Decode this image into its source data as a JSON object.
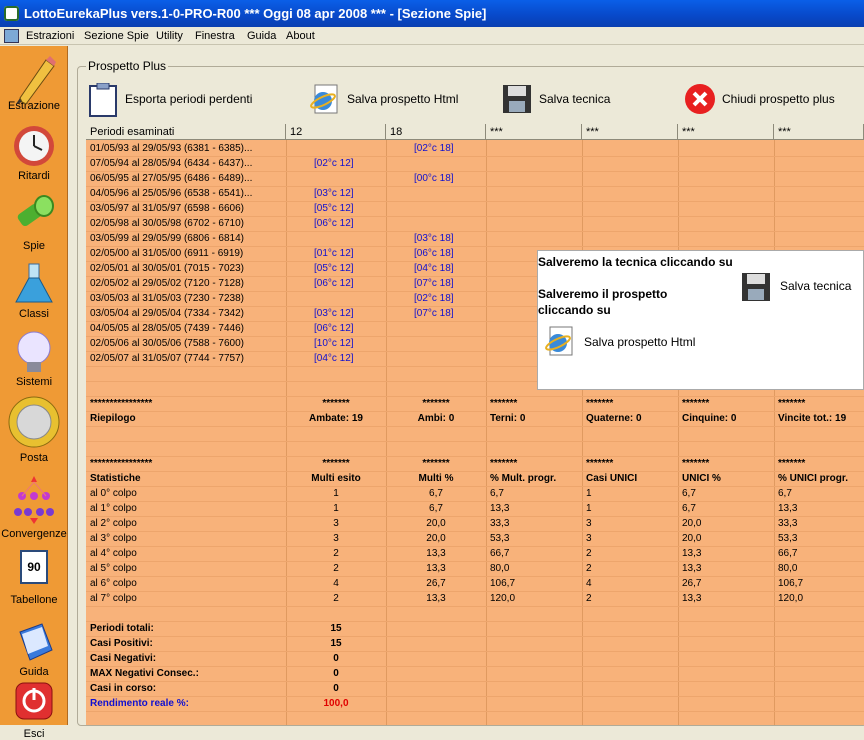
{
  "window": {
    "title": "LottoEurekaPlus vers.1-0-PRO-R00  ***  Oggi 08 apr 2008  ***   - [Sezione Spie]"
  },
  "menu": [
    "Estrazioni",
    "Sezione Spie",
    "Utility",
    "Finestra",
    "Guida",
    "About"
  ],
  "sidebar": [
    "Estrazione",
    "Ritardi",
    "Spie",
    "Classi",
    "Sistemi",
    "Posta",
    "Convergenze",
    "Tabellone",
    "Guida",
    "Esci"
  ],
  "sidebar_badge": "90",
  "panel_title": "Prospetto Plus",
  "toolbar": {
    "export": "Esporta periodi perdenti",
    "save_html": "Salva prospetto Html",
    "save_tech": "Salva tecnica",
    "close": "Chiudi prospetto plus"
  },
  "columns": [
    "Periodi esaminati",
    "12",
    "18",
    "***",
    "***",
    "***",
    "***"
  ],
  "periods": [
    {
      "label": "01/05/93 al 29/05/93  (6381 - 6385)...",
      "c12": "",
      "c18": "[02°c 18]"
    },
    {
      "label": "07/05/94 al 28/05/94  (6434 - 6437)...",
      "c12": "[02°c 12]",
      "c18": ""
    },
    {
      "label": "06/05/95 al 27/05/95  (6486 - 6489)...",
      "c12": "",
      "c18": "[00°c 18]"
    },
    {
      "label": "04/05/96 al 25/05/96  (6538 - 6541)...",
      "c12": "[03°c 12]",
      "c18": ""
    },
    {
      "label": "03/05/97 al 31/05/97  (6598 - 6606)",
      "c12": "[05°c 12]",
      "c18": ""
    },
    {
      "label": "02/05/98 al 30/05/98  (6702 - 6710)",
      "c12": "[06°c 12]",
      "c18": ""
    },
    {
      "label": "03/05/99 al 29/05/99  (6806 - 6814)",
      "c12": "",
      "c18": "[03°c 18]"
    },
    {
      "label": "02/05/00 al 31/05/00  (6911 - 6919)",
      "c12": "[01°c 12]",
      "c18": "[06°c 18]"
    },
    {
      "label": "02/05/01 al 30/05/01  (7015 - 7023)",
      "c12": "[05°c 12]",
      "c18": "[04°c 18]"
    },
    {
      "label": "02/05/02 al 29/05/02  (7120 - 7128)",
      "c12": "[06°c 12]",
      "c18": "[07°c 18]"
    },
    {
      "label": "03/05/03 al 31/05/03  (7230 - 7238)",
      "c12": "",
      "c18": "[02°c 18]"
    },
    {
      "label": "03/05/04 al 29/05/04  (7334 - 7342)",
      "c12": "[03°c 12]",
      "c18": "[07°c 18]"
    },
    {
      "label": "04/05/05 al 28/05/05  (7439 - 7446)",
      "c12": "[06°c 12]",
      "c18": ""
    },
    {
      "label": "02/05/06 al 30/05/06  (7588 - 7600)",
      "c12": "[10°c 12]",
      "c18": ""
    },
    {
      "label": "02/05/07 al 31/05/07  (7744 - 7757)",
      "c12": "[04°c 12]",
      "c18": ""
    }
  ],
  "riepilogo": {
    "stars": [
      "****************",
      "*******",
      "*******",
      "*******",
      "*******",
      "*******",
      "*******"
    ],
    "cells": [
      "Riepilogo",
      "Ambate: 19",
      "Ambi: 0",
      "Terni: 0",
      "Quaterne: 0",
      "Cinquine: 0",
      "Vincite tot.: 19"
    ]
  },
  "statistiche": {
    "stars": [
      "****************",
      "*******",
      "*******",
      "*******",
      "*******",
      "*******",
      "*******"
    ],
    "header": [
      "Statistiche",
      "Multi esito",
      "Multi %",
      "% Mult. progr.",
      "Casi UNICI",
      "UNICI %",
      "% UNICI progr."
    ],
    "rows": [
      [
        "al 0° colpo",
        "1",
        "6,7",
        "6,7",
        "1",
        "6,7",
        "6,7"
      ],
      [
        "al 1° colpo",
        "1",
        "6,7",
        "13,3",
        "1",
        "6,7",
        "13,3"
      ],
      [
        "al 2° colpo",
        "3",
        "20,0",
        "33,3",
        "3",
        "20,0",
        "33,3"
      ],
      [
        "al 3° colpo",
        "3",
        "20,0",
        "53,3",
        "3",
        "20,0",
        "53,3"
      ],
      [
        "al 4° colpo",
        "2",
        "13,3",
        "66,7",
        "2",
        "13,3",
        "66,7"
      ],
      [
        "al 5° colpo",
        "2",
        "13,3",
        "80,0",
        "2",
        "13,3",
        "80,0"
      ],
      [
        "al 6° colpo",
        "4",
        "26,7",
        "106,7",
        "4",
        "26,7",
        "106,7"
      ],
      [
        "al 7° colpo",
        "2",
        "13,3",
        "120,0",
        "2",
        "13,3",
        "120,0"
      ]
    ]
  },
  "totals": [
    {
      "label": "Periodi totali:",
      "value": "15"
    },
    {
      "label": "Casi Positivi:",
      "value": "15"
    },
    {
      "label": "Casi Negativi:",
      "value": "0"
    },
    {
      "label": "MAX Negativi Consec.:",
      "value": "0"
    },
    {
      "label": "Casi in corso:",
      "value": "0"
    },
    {
      "label": "Rendimento reale %:",
      "value": "100,0"
    }
  ],
  "popup": {
    "line1": "Salveremo la tecnica cliccando su",
    "line2a": "Salveremo il prospetto",
    "line2b": "cliccando su",
    "tech_label": "Salva tecnica",
    "html_label": "Salva prospetto Html"
  }
}
